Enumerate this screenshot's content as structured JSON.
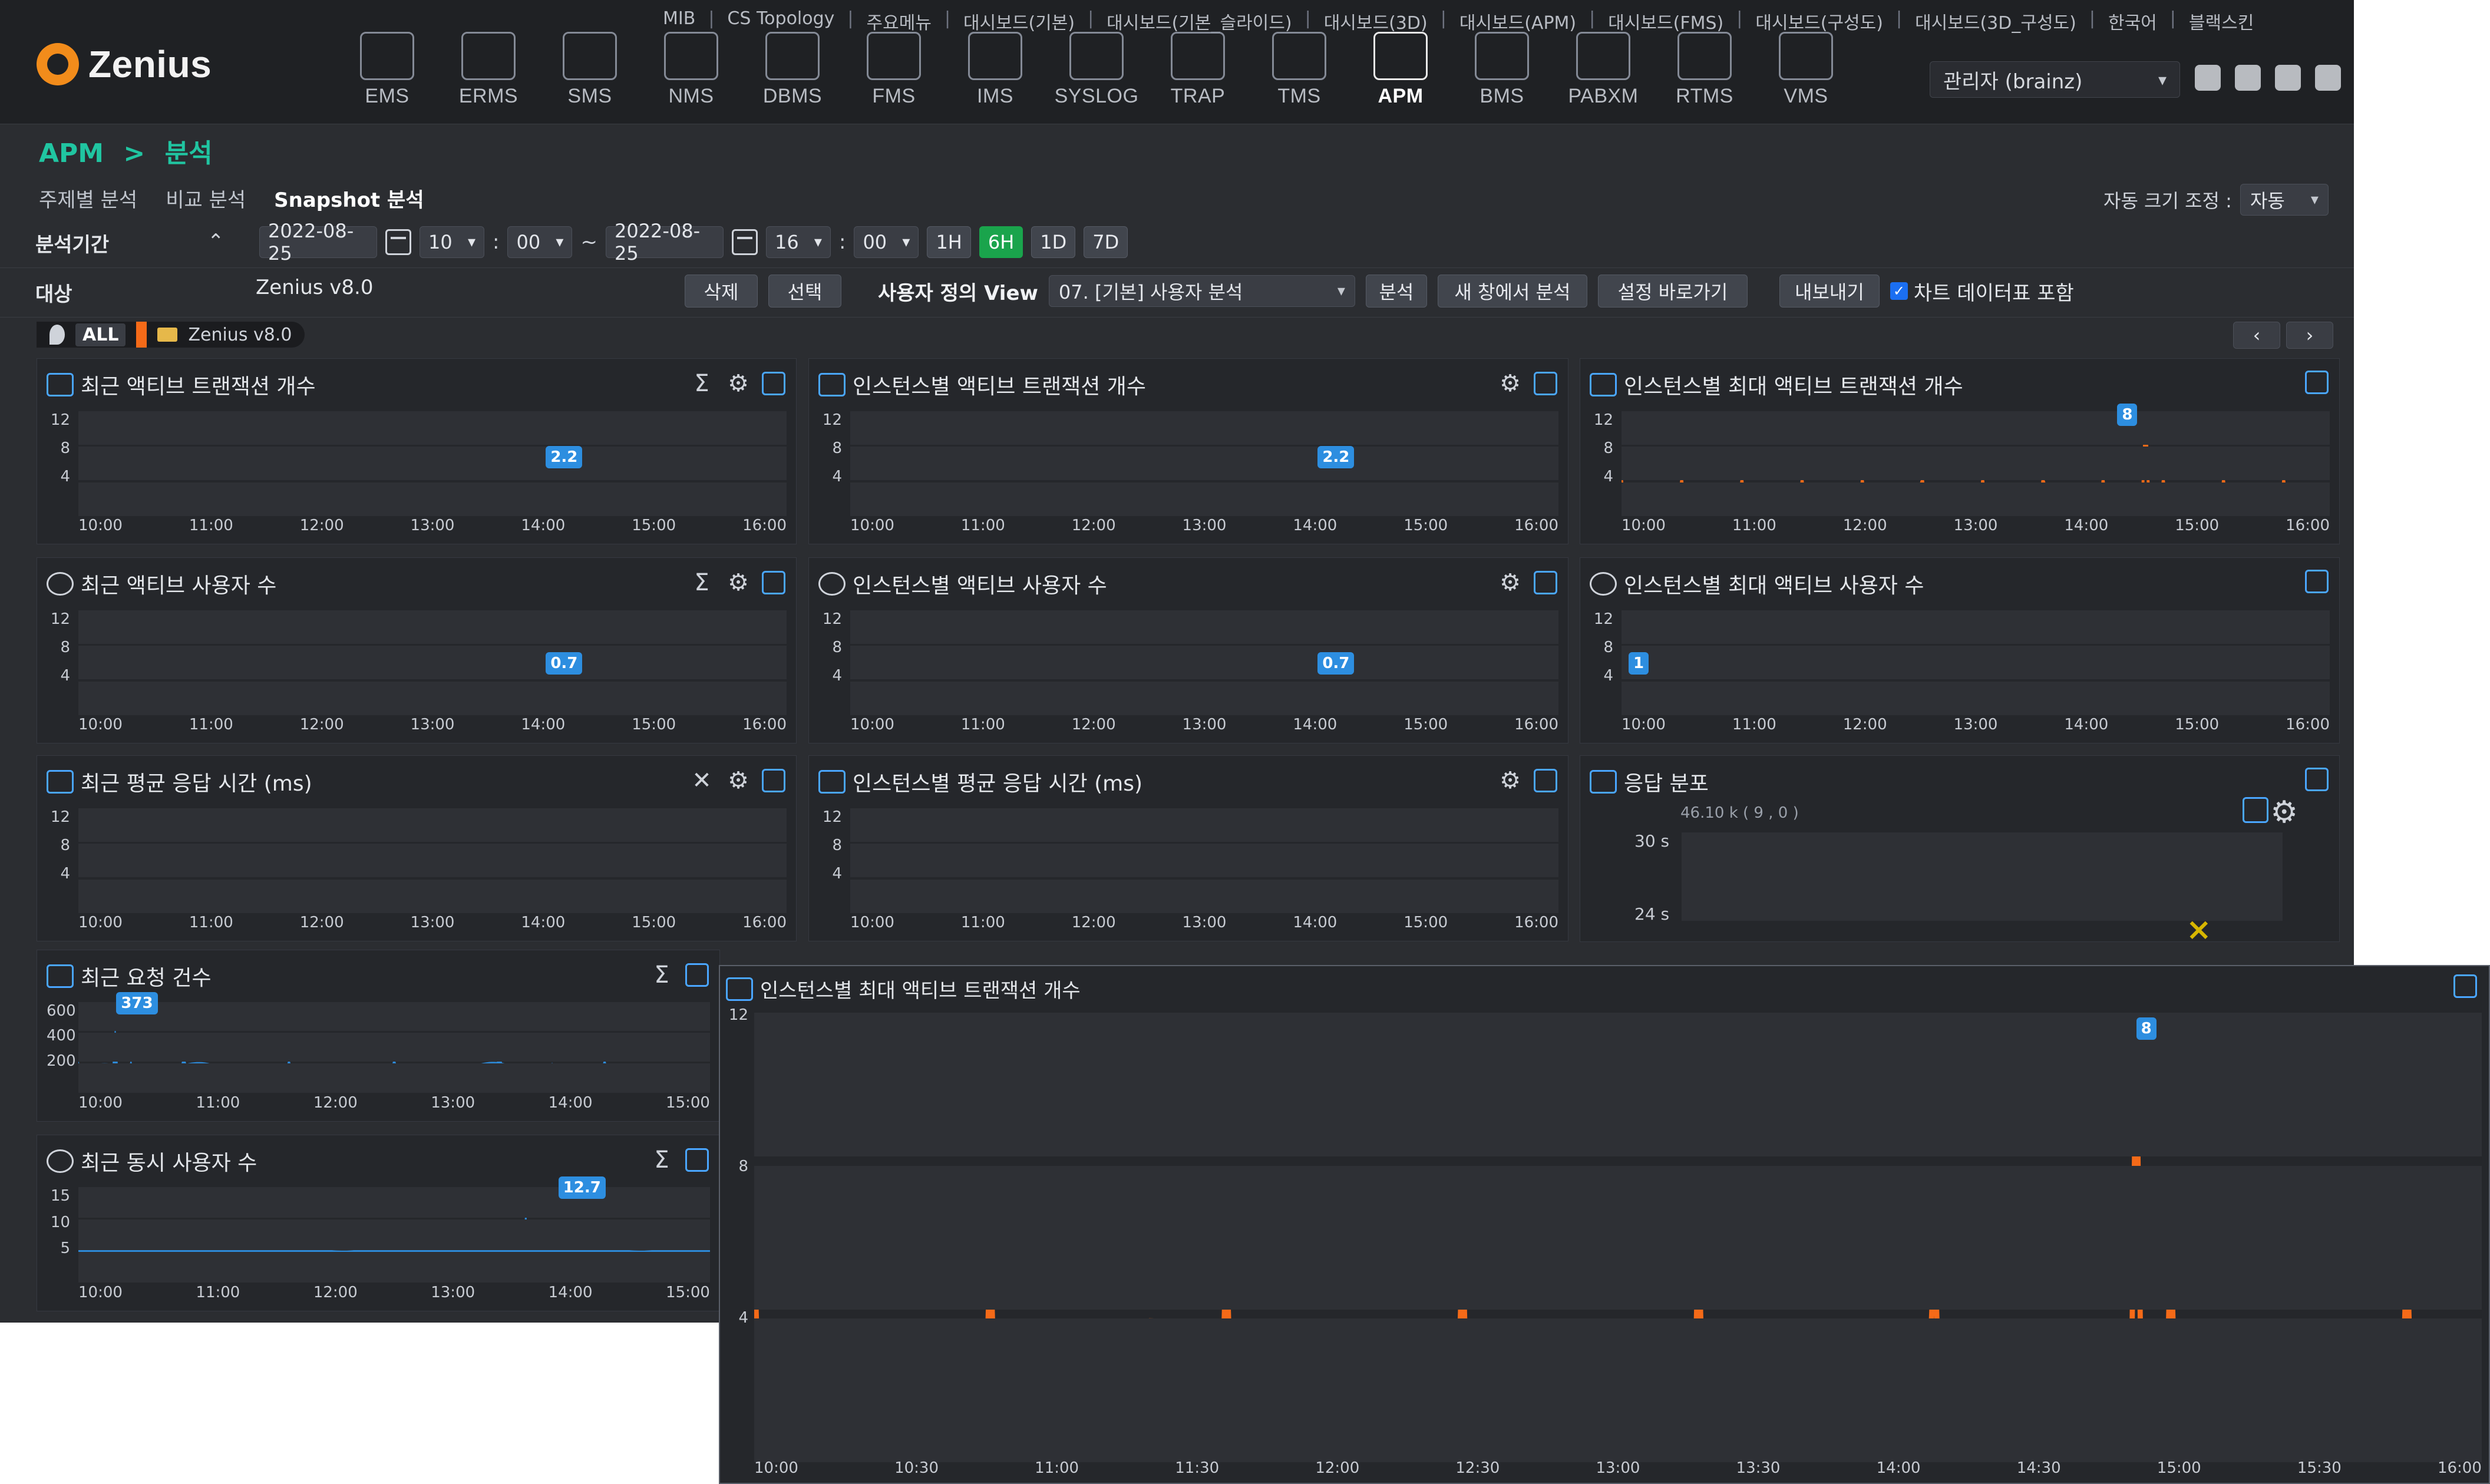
{
  "app": {
    "brand": "Zenius",
    "top_menu": [
      "MIB",
      "CS Topology",
      "주요메뉴",
      "대시보드(기본)",
      "대시보드(기본_슬라이드)",
      "대시보드(3D)",
      "대시보드(APM)",
      "대시보드(FMS)",
      "대시보드(구성도)",
      "대시보드(3D_구성도)",
      "한국어",
      "블랙스킨"
    ],
    "modules": [
      "EMS",
      "ERMS",
      "SMS",
      "NMS",
      "DBMS",
      "FMS",
      "IMS",
      "SYSLOG",
      "TRAP",
      "TMS",
      "APM",
      "BMS",
      "PABXM",
      "RTMS",
      "VMS"
    ],
    "active_module": "APM",
    "user": "관리자 (brainz)"
  },
  "breadcrumb": {
    "root": "APM",
    "sep": ">",
    "current": "분석"
  },
  "tabs": [
    {
      "label": "주제별 분석",
      "active": false
    },
    {
      "label": "비교 분석",
      "active": false
    },
    {
      "label": "Snapshot 분석",
      "active": true
    }
  ],
  "autosize": {
    "label": "자동 크기 조정 :",
    "value": "자동"
  },
  "filters": {
    "period_label": "분석기간",
    "start_date": "2022-08-25",
    "start_hour": "10",
    "start_min": "00",
    "tilde": "~",
    "end_date": "2022-08-25",
    "end_hour": "16",
    "end_min": "00",
    "ranges": [
      "1H",
      "6H",
      "1D",
      "7D"
    ],
    "active_range": "6H",
    "target_label": "대상",
    "target_value": "Zenius v8.0",
    "delete": "삭제",
    "select": "선택",
    "view_label": "사용자 정의 View",
    "view_value": "07. [기본] 사용자 분석",
    "analyze": "분석",
    "analyze_new": "새 창에서 분석",
    "setting_shortcut": "설정 바로가기",
    "export": "내보내기",
    "include_chart": "차트 데이터표 포함",
    "include_chart_checked": true
  },
  "chip": {
    "all": "ALL",
    "instance": "Zenius v8.0"
  },
  "time_axis": [
    "10:00",
    "11:00",
    "12:00",
    "13:00",
    "14:00",
    "15:00",
    "16:00"
  ],
  "panels": [
    {
      "title": "최근 액티브 트랜잭션 개수",
      "y": [
        12,
        8,
        4
      ],
      "marker": "2.2",
      "kind": "blue-small"
    },
    {
      "title": "인스턴스별 액티브 트랜잭션 개수",
      "y": [
        12,
        8,
        4
      ],
      "marker": "2.2",
      "kind": "orange-flat"
    },
    {
      "title": "인스턴스별 최대 액티브 트랜잭션 개수",
      "y": [
        12,
        8,
        4
      ],
      "marker": "8",
      "kind": "orange-spike"
    },
    {
      "title": "최근 액티브 사용자 수",
      "y": [
        12,
        8,
        4
      ],
      "marker": "0.7",
      "kind": "blue-small"
    },
    {
      "title": "인스턴스별 액티브 사용자 수",
      "y": [
        12,
        8,
        4
      ],
      "marker": "0.7",
      "kind": "orange-flat"
    },
    {
      "title": "인스턴스별 최대 액티브 사용자 수",
      "y": [
        12,
        8,
        4
      ],
      "marker": "1",
      "kind": "orange-low"
    },
    {
      "title": "최근 평균 응답 시간 (ms)",
      "y": [
        12,
        8,
        4
      ],
      "marker": "",
      "kind": "blue-flat"
    },
    {
      "title": "인스턴스별 평균 응답 시간 (ms)",
      "y": [
        12,
        8,
        4
      ],
      "marker": "",
      "kind": "orange-flat"
    },
    {
      "title": "응답 분포",
      "legend": "46.10 k ( 9 , 0 )",
      "y": [
        "30 s",
        "24 s"
      ]
    },
    {
      "title": "최근 요청 건수",
      "y": [
        600,
        400,
        200
      ],
      "marker": "373",
      "kind": "blue-area"
    },
    {
      "title": "최근 동시 사용자 수",
      "y": [
        15,
        10,
        5
      ],
      "marker": "12.7",
      "kind": "blue-area2"
    }
  ],
  "popup": {
    "title": "인스턴스별 최대 액티브 트랜잭션 개수",
    "y": [
      12,
      8,
      4
    ],
    "x": [
      "10:00",
      "10:30",
      "11:00",
      "11:30",
      "12:00",
      "12:30",
      "13:00",
      "13:30",
      "14:00",
      "14:30",
      "15:00",
      "15:30",
      "16:00"
    ],
    "marker": "8"
  }
}
